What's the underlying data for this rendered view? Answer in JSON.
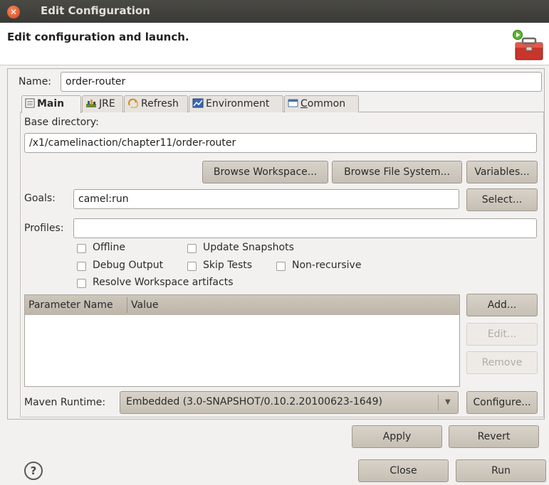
{
  "window": {
    "title": "Edit Configuration"
  },
  "header": {
    "title": "Edit configuration and launch."
  },
  "name_field": {
    "label": "Name:",
    "value": "order-router"
  },
  "tabs": [
    {
      "label": "Main",
      "icon": "document-icon",
      "active": true
    },
    {
      "label": "JRE",
      "icon": "library-icon",
      "active": false
    },
    {
      "label": "Refresh",
      "icon": "refresh-icon",
      "active": false
    },
    {
      "label": "Environment",
      "icon": "environment-icon",
      "active": false
    },
    {
      "label": "Common",
      "icon": "window-icon",
      "active": false
    }
  ],
  "main": {
    "base_dir_label": "Base directory:",
    "base_dir_value": "/x1/camelinaction/chapter11/order-router",
    "browse_workspace": "Browse Workspace...",
    "browse_fs": "Browse File System...",
    "variables": "Variables...",
    "goals_label": "Goals:",
    "goals_value": "camel:run",
    "select": "Select...",
    "profiles_label": "Profiles:",
    "profiles_value": "",
    "checkboxes": {
      "offline": "Offline",
      "update_snapshots": "Update Snapshots",
      "debug_output": "Debug Output",
      "skip_tests": "Skip Tests",
      "non_recursive": "Non-recursive",
      "resolve_workspace": "Resolve Workspace artifacts"
    },
    "params_table": {
      "columns": [
        "Parameter Name",
        "Value"
      ],
      "rows": []
    },
    "add": "Add...",
    "edit": "Edit...",
    "remove": "Remove",
    "runtime_label": "Maven Runtime:",
    "runtime_value": "Embedded (3.0-SNAPSHOT/0.10.2.20100623-1649)",
    "configure": "Configure..."
  },
  "apply": "Apply",
  "revert": "Revert",
  "close": "Close",
  "run": "Run",
  "colors": {
    "titlebar": "#3e3d39",
    "button": "#c9c2b7",
    "close_button": "#e05a2b"
  }
}
